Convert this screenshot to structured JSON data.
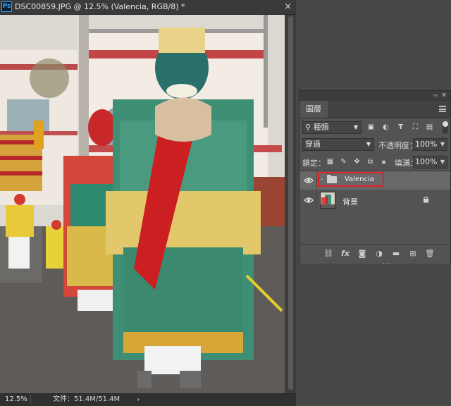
{
  "document": {
    "app_icon_label": "Ps",
    "tab_title": "DSC00859.JPG @ 12.5% (Valencia, RGB/8) *",
    "close_symbol": "×",
    "zoom": "12.5%",
    "doc_info": "文件：51.4M/51.4M",
    "status_arrow": "›"
  },
  "layers_panel": {
    "tab_label": "圖層",
    "filter_kind": "種類",
    "blend_mode": "穿過",
    "opacity_label": "不透明度：",
    "opacity_value": "100%",
    "lock_label": "鎖定：",
    "fill_label": "填滿：",
    "fill_value": "100%",
    "layers": [
      {
        "name": "Valencia",
        "type": "group",
        "visible": true,
        "selected": true,
        "highlighted": true
      },
      {
        "name": "背景",
        "type": "pixel",
        "visible": true,
        "locked": true
      }
    ],
    "footer_icons": [
      "link-layers-icon",
      "fx-icon",
      "add-mask-icon",
      "adjustment-layer-icon",
      "new-group-icon",
      "new-layer-icon",
      "delete-layer-icon"
    ],
    "fx_label": "fx"
  },
  "colors": {
    "highlight": "#e0202a",
    "ps_blue": "#31a8ff",
    "panel_bg": "#535353",
    "selected_row": "#686868"
  }
}
